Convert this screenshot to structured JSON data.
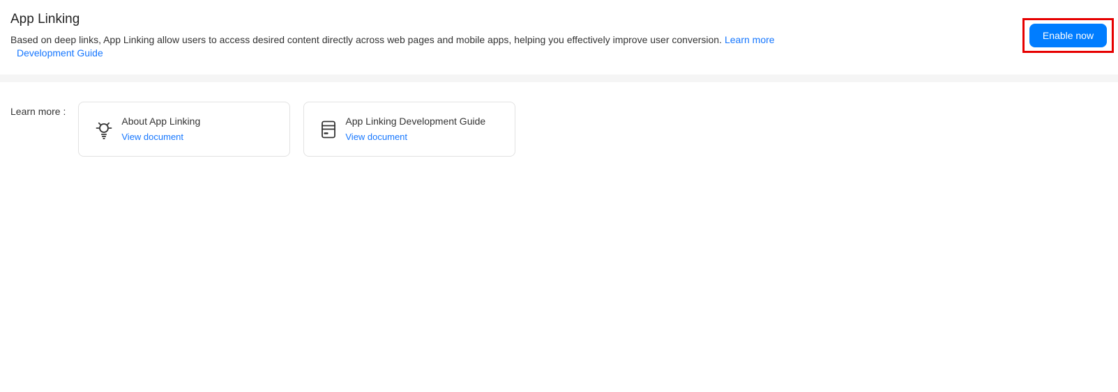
{
  "header": {
    "title": "App Linking",
    "description": "Based on deep links, App Linking allow users to access desired content directly across web pages and mobile apps, helping you effectively improve user conversion.",
    "learn_more_link": "Learn more",
    "development_guide_link": "Development Guide",
    "enable_button": "Enable now"
  },
  "annotation": {
    "shape": "red-rectangle",
    "target": "Enable now button"
  },
  "learn_more_section": {
    "label": "Learn more :",
    "cards": [
      {
        "icon": "lightbulb-icon",
        "title": "About App Linking",
        "link": "View document"
      },
      {
        "icon": "document-icon",
        "title": "App Linking Development Guide",
        "link": "View document"
      }
    ]
  },
  "colors": {
    "primary_blue": "#007dff",
    "link_blue": "#1677ff",
    "annotation_red": "#e60000",
    "divider_gray": "#f5f5f5"
  }
}
